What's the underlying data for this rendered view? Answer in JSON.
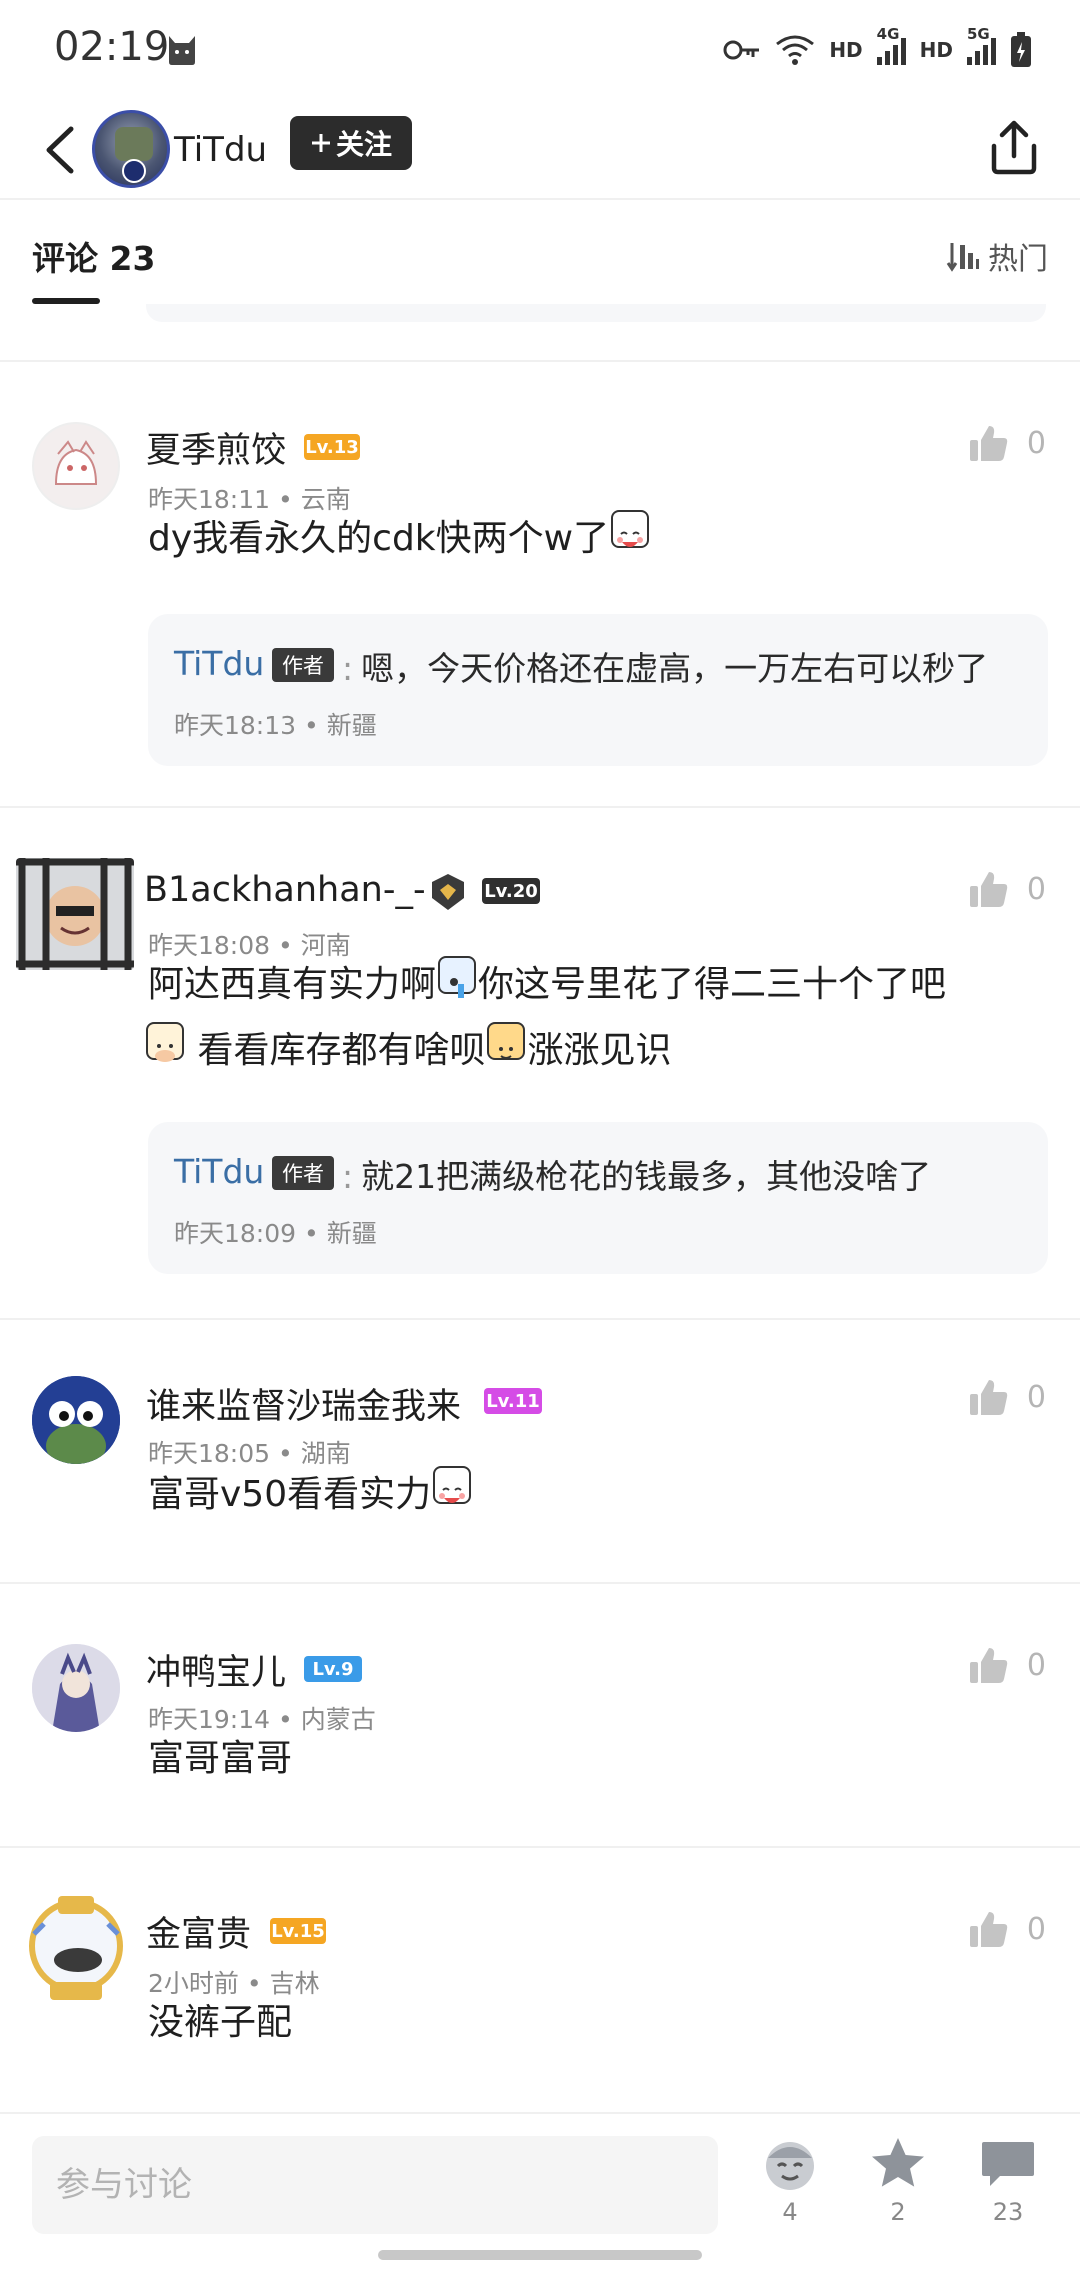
{
  "status": {
    "time": "02:19",
    "hd1": "HD",
    "net1": "4G",
    "hd2": "HD",
    "net2": "5G"
  },
  "header": {
    "author_name": "TiTdu",
    "follow_label": "关注"
  },
  "tabs": {
    "comments_label": "评论 23",
    "sort_label": "热门"
  },
  "comments": [
    {
      "name": "夏季煎饺",
      "level": "Lv.13",
      "level_color": "#f5a623",
      "time": "昨天18:11",
      "region": "云南",
      "text": "dy我看永久的cdk快两个w了",
      "likes": "0",
      "reply": {
        "name": "TiTdu",
        "badge": "作者",
        "text": "嗯，今天价格还在虚高，一万左右可以秒了",
        "time": "昨天18:13",
        "region": "新疆"
      }
    },
    {
      "name": "B1ackhanhan-_-",
      "level": "Lv.20",
      "level_color": "#2f2f2f",
      "time": "昨天18:08",
      "region": "河南",
      "text_line1": "阿达西真有实力啊",
      "text_line1b": "你这号里花了得二三十个了吧",
      "text_line2a": "看看库存都有啥呗",
      "text_line2b": "涨涨见识",
      "likes": "0",
      "reply": {
        "name": "TiTdu",
        "badge": "作者",
        "text": "就21把满级枪花的钱最多，其他没啥了",
        "time": "昨天18:09",
        "region": "新疆"
      }
    },
    {
      "name": "谁来监督沙瑞金我来",
      "level": "Lv.11",
      "level_color": "#d54ce6",
      "time": "昨天18:05",
      "region": "湖南",
      "text": "富哥v50看看实力",
      "likes": "0"
    },
    {
      "name": "冲鸭宝儿",
      "level": "Lv.9",
      "level_color": "#3a9be8",
      "time": "昨天19:14",
      "region": "内蒙古",
      "text": "富哥富哥",
      "likes": "0"
    },
    {
      "name": "金富贵",
      "level": "Lv.15",
      "level_color": "#f5a623",
      "time": "2小时前",
      "region": "吉林",
      "text": "没裤子配",
      "likes": "0"
    }
  ],
  "meta_separator": "•",
  "reply_colon": ":",
  "bottom": {
    "input_placeholder": "参与讨论",
    "reward_count": "4",
    "favorite_count": "2",
    "comment_count": "23"
  },
  "icons": [
    "back-icon",
    "share-icon",
    "sort-icon",
    "thumb-up-icon",
    "star-icon",
    "comment-icon",
    "wifi-icon",
    "key-icon",
    "battery-icon",
    "cat-icon"
  ]
}
